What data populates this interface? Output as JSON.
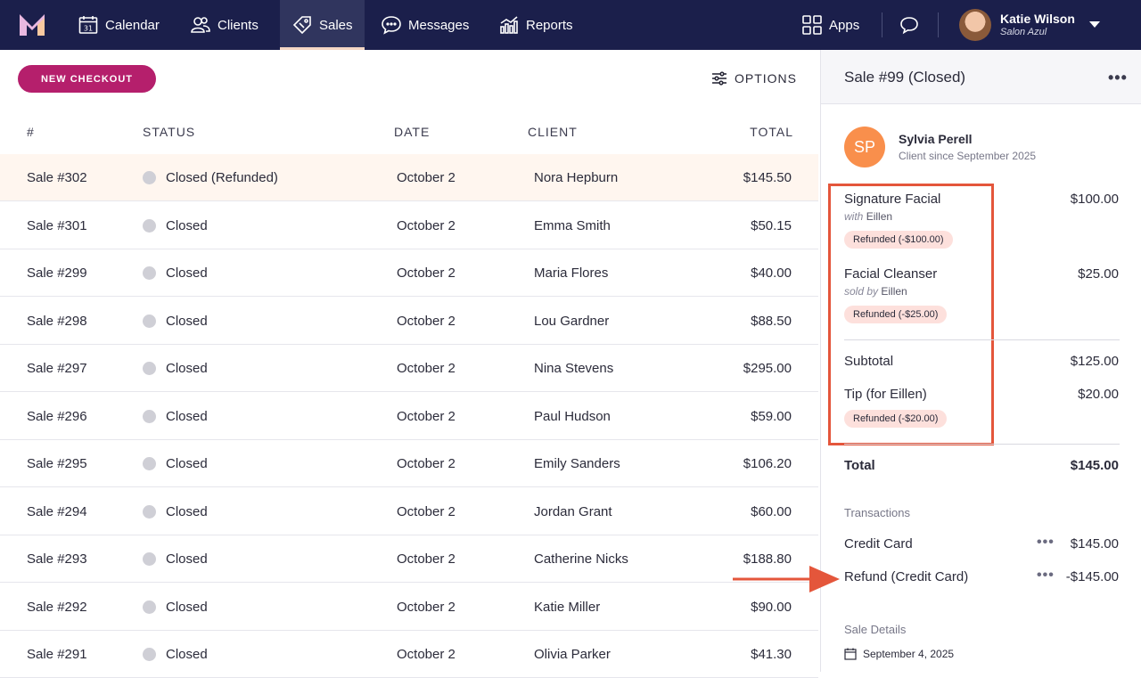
{
  "nav": {
    "items": [
      {
        "label": "Calendar",
        "icon": "calendar-icon"
      },
      {
        "label": "Clients",
        "icon": "clients-icon"
      },
      {
        "label": "Sales",
        "icon": "tag-icon"
      },
      {
        "label": "Messages",
        "icon": "chat-icon"
      },
      {
        "label": "Reports",
        "icon": "chart-icon"
      }
    ],
    "apps_label": "Apps",
    "calendar_day": "31",
    "user_name": "Katie Wilson",
    "user_salon": "Salon Azul"
  },
  "toolbar": {
    "new_checkout": "NEW CHECKOUT",
    "options": "OPTIONS"
  },
  "table": {
    "headers": [
      "#",
      "STATUS",
      "DATE",
      "CLIENT",
      "TOTAL"
    ],
    "rows": [
      {
        "id": "Sale #302",
        "status": "Closed (Refunded)",
        "date": "October 2",
        "client": "Nora Hepburn",
        "total": "$145.50"
      },
      {
        "id": "Sale #301",
        "status": "Closed",
        "date": "October 2",
        "client": "Emma Smith",
        "total": "$50.15"
      },
      {
        "id": "Sale #299",
        "status": "Closed",
        "date": "October 2",
        "client": "Maria Flores",
        "total": "$40.00"
      },
      {
        "id": "Sale #298",
        "status": "Closed",
        "date": "October 2",
        "client": "Lou Gardner",
        "total": "$88.50"
      },
      {
        "id": "Sale #297",
        "status": "Closed",
        "date": "October 2",
        "client": "Nina Stevens",
        "total": "$295.00"
      },
      {
        "id": "Sale #296",
        "status": "Closed",
        "date": "October 2",
        "client": "Paul Hudson",
        "total": "$59.00"
      },
      {
        "id": "Sale #295",
        "status": "Closed",
        "date": "October 2",
        "client": "Emily Sanders",
        "total": "$106.20"
      },
      {
        "id": "Sale #294",
        "status": "Closed",
        "date": "October 2",
        "client": "Jordan Grant",
        "total": "$60.00"
      },
      {
        "id": "Sale #293",
        "status": "Closed",
        "date": "October 2",
        "client": "Catherine Nicks",
        "total": "$188.80"
      },
      {
        "id": "Sale #292",
        "status": "Closed",
        "date": "October 2",
        "client": "Katie Miller",
        "total": "$90.00"
      },
      {
        "id": "Sale #291",
        "status": "Closed",
        "date": "October 2",
        "client": "Olivia Parker",
        "total": "$41.30"
      }
    ]
  },
  "panel": {
    "title": "Sale #99 (Closed)",
    "more": "•••",
    "client_initials": "SP",
    "client_name": "Sylvia Perell",
    "client_since": "Client since September 2025",
    "item1_name": "Signature Facial",
    "item1_sub_prefix": "with",
    "item1_sub_name": "Eillen",
    "item1_amount": "$100.00",
    "item1_badge": "Refunded (-$100.00)",
    "item2_name": "Facial Cleanser",
    "item2_sub_prefix": "sold by",
    "item2_sub_name": "Eillen",
    "item2_amount": "$25.00",
    "item2_badge": "Refunded (-$25.00)",
    "subtotal_label": "Subtotal",
    "subtotal_amount": "$125.00",
    "tip_label": "Tip (for Eillen)",
    "tip_amount": "$20.00",
    "tip_badge": "Refunded (-$20.00)",
    "total_label": "Total",
    "total_amount": "$145.00",
    "transactions_label": "Transactions",
    "tx1_label": "Credit Card",
    "tx1_amount": "$145.00",
    "tx2_label": "Refund (Credit Card)",
    "tx2_amount": "-$145.00",
    "tx_more": "•••",
    "details_label": "Sale Details",
    "details_date": "September 4, 2025"
  },
  "colors": {
    "nav_bg": "#1b1f4b",
    "accent": "#b51f6c",
    "highlight": "#e4563b",
    "avatar": "#f98f4c"
  }
}
